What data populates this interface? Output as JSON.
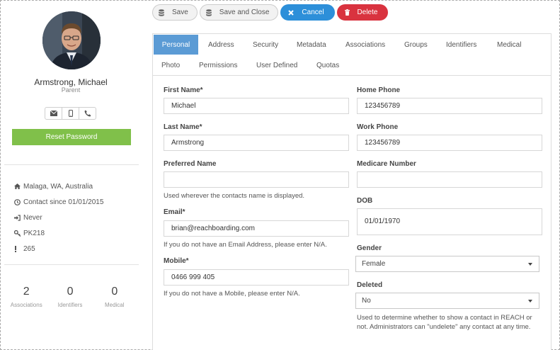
{
  "contact": {
    "name": "Armstrong, Michael",
    "role": "Parent",
    "reset_label": "Reset Password",
    "info": [
      {
        "icon": "home-icon",
        "text": "Malaga, WA, Australia"
      },
      {
        "icon": "clock-icon",
        "text": "Contact since 01/01/2015"
      },
      {
        "icon": "sign-in-icon",
        "text": "Never"
      },
      {
        "icon": "key-icon",
        "text": "PK218"
      },
      {
        "icon": "exclamation-icon",
        "text": "265"
      }
    ],
    "stats": [
      {
        "value": "2",
        "label": "Associations"
      },
      {
        "value": "0",
        "label": "Identifiers"
      },
      {
        "value": "0",
        "label": "Medical"
      }
    ]
  },
  "toolbar": {
    "save": "Save",
    "save_close": "Save and Close",
    "cancel": "Cancel",
    "delete": "Delete"
  },
  "tabs": [
    "Personal",
    "Address",
    "Security",
    "Metadata",
    "Associations",
    "Groups",
    "Identifiers",
    "Medical",
    "Photo",
    "Permissions",
    "User Defined",
    "Quotas"
  ],
  "active_tab": "Personal",
  "form": {
    "first_name": {
      "label": "First Name*",
      "value": "Michael"
    },
    "last_name": {
      "label": "Last Name*",
      "value": "Armstrong"
    },
    "preferred_name": {
      "label": "Preferred Name",
      "value": "",
      "help": "Used wherever the contacts name is displayed."
    },
    "email": {
      "label": "Email*",
      "value": "brian@reachboarding.com",
      "help": "If you do not have an Email Address, please enter N/A."
    },
    "mobile": {
      "label": "Mobile*",
      "value": "0466 999 405",
      "help": "If you do not have a Mobile, please enter N/A."
    },
    "home_phone": {
      "label": "Home Phone",
      "value": "123456789"
    },
    "work_phone": {
      "label": "Work Phone",
      "value": "123456789"
    },
    "medicare": {
      "label": "Medicare Number",
      "value": ""
    },
    "dob": {
      "label": "DOB",
      "value": "01/01/1970"
    },
    "gender": {
      "label": "Gender",
      "value": "Female"
    },
    "deleted": {
      "label": "Deleted",
      "value": "No",
      "help": "Used to determine whether to show a contact in REACH or not. Administrators can \"undelete\" any contact at any time."
    }
  },
  "colors": {
    "tab_active": "#5b9bd5",
    "reset": "#80c04a",
    "cancel": "#2d8fd9",
    "delete": "#d9333f"
  }
}
